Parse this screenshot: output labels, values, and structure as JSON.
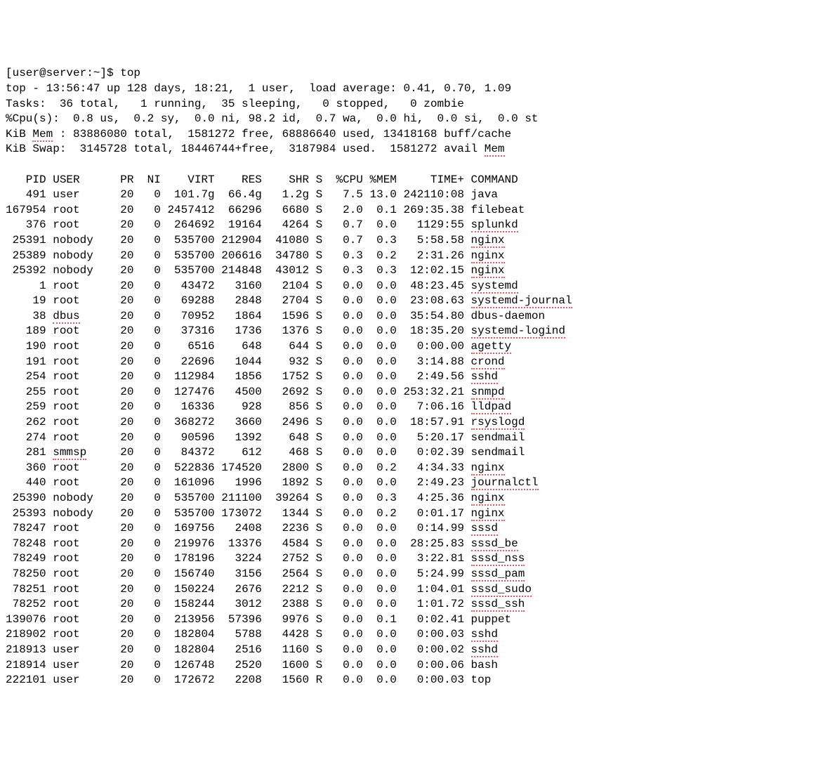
{
  "prompt": "[user@server:~]$ top",
  "summary": {
    "line1": "top - 13:56:47 up 128 days, 18:21,  1 user,  load average: 0.41, 0.70, 1.09",
    "line2": "Tasks:  36 total,   1 running,  35 sleeping,   0 stopped,   0 zombie",
    "line3": "%Cpu(s):  0.8 us,  0.2 sy,  0.0 ni, 98.2 id,  0.7 wa,  0.0 hi,  0.0 si,  0.0 st",
    "mem_prefix": "KiB ",
    "mem_word": "Mem",
    "mem_rest": " : 83886080 total,  1581272 free, 68886640 used, 13418168 buff/cache",
    "swap_prefix": "KiB Swap:  3145728 total, 18446744+free,  3187984 used.  1581272 avail ",
    "swap_word": "Mem"
  },
  "columns": {
    "pid": "PID",
    "user": "USER",
    "pr": "PR",
    "ni": "NI",
    "virt": "VIRT",
    "res": "RES",
    "shr": "SHR",
    "s": "S",
    "cpu": "%CPU",
    "mem": "%MEM",
    "time": "TIME+",
    "command": "COMMAND"
  },
  "processes": [
    {
      "pid": "491",
      "user": "user",
      "pr": "20",
      "ni": "0",
      "virt": "101.7g",
      "res": "66.4g",
      "shr": "1.2g",
      "s": "S",
      "cpu": "7.5",
      "mem": "13.0",
      "time": "242110:08",
      "command": "java",
      "underline": false
    },
    {
      "pid": "167954",
      "user": "root",
      "pr": "20",
      "ni": "0",
      "virt": "2457412",
      "res": "66296",
      "shr": "6680",
      "s": "S",
      "cpu": "2.0",
      "mem": "0.1",
      "time": "269:35.38",
      "command": "filebeat",
      "underline": false
    },
    {
      "pid": "376",
      "user": "root",
      "pr": "20",
      "ni": "0",
      "virt": "264692",
      "res": "19164",
      "shr": "4264",
      "s": "S",
      "cpu": "0.7",
      "mem": "0.0",
      "time": "1129:55",
      "command": "splunkd",
      "underline": true
    },
    {
      "pid": "25391",
      "user": "nobody",
      "pr": "20",
      "ni": "0",
      "virt": "535700",
      "res": "212904",
      "shr": "41080",
      "s": "S",
      "cpu": "0.7",
      "mem": "0.3",
      "time": "5:58.58",
      "command": "nginx",
      "underline": true
    },
    {
      "pid": "25389",
      "user": "nobody",
      "pr": "20",
      "ni": "0",
      "virt": "535700",
      "res": "206616",
      "shr": "34780",
      "s": "S",
      "cpu": "0.3",
      "mem": "0.2",
      "time": "2:31.26",
      "command": "nginx",
      "underline": true
    },
    {
      "pid": "25392",
      "user": "nobody",
      "pr": "20",
      "ni": "0",
      "virt": "535700",
      "res": "214848",
      "shr": "43012",
      "s": "S",
      "cpu": "0.3",
      "mem": "0.3",
      "time": "12:02.15",
      "command": "nginx",
      "underline": true
    },
    {
      "pid": "1",
      "user": "root",
      "pr": "20",
      "ni": "0",
      "virt": "43472",
      "res": "3160",
      "shr": "2104",
      "s": "S",
      "cpu": "0.0",
      "mem": "0.0",
      "time": "48:23.45",
      "command": "systemd",
      "underline": true
    },
    {
      "pid": "19",
      "user": "root",
      "pr": "20",
      "ni": "0",
      "virt": "69288",
      "res": "2848",
      "shr": "2704",
      "s": "S",
      "cpu": "0.0",
      "mem": "0.0",
      "time": "23:08.63",
      "command": "systemd-journal",
      "underline": true
    },
    {
      "pid": "38",
      "user": "dbus",
      "pr": "20",
      "ni": "0",
      "virt": "70952",
      "res": "1864",
      "shr": "1596",
      "s": "S",
      "cpu": "0.0",
      "mem": "0.0",
      "time": "35:54.80",
      "command": "dbus-daemon",
      "underline": false,
      "user_underline": true
    },
    {
      "pid": "189",
      "user": "root",
      "pr": "20",
      "ni": "0",
      "virt": "37316",
      "res": "1736",
      "shr": "1376",
      "s": "S",
      "cpu": "0.0",
      "mem": "0.0",
      "time": "18:35.20",
      "command": "systemd-logind",
      "underline": true
    },
    {
      "pid": "190",
      "user": "root",
      "pr": "20",
      "ni": "0",
      "virt": "6516",
      "res": "648",
      "shr": "644",
      "s": "S",
      "cpu": "0.0",
      "mem": "0.0",
      "time": "0:00.00",
      "command": "agetty",
      "underline": true
    },
    {
      "pid": "191",
      "user": "root",
      "pr": "20",
      "ni": "0",
      "virt": "22696",
      "res": "1044",
      "shr": "932",
      "s": "S",
      "cpu": "0.0",
      "mem": "0.0",
      "time": "3:14.88",
      "command": "crond",
      "underline": true
    },
    {
      "pid": "254",
      "user": "root",
      "pr": "20",
      "ni": "0",
      "virt": "112984",
      "res": "1856",
      "shr": "1752",
      "s": "S",
      "cpu": "0.0",
      "mem": "0.0",
      "time": "2:49.56",
      "command": "sshd",
      "underline": true
    },
    {
      "pid": "255",
      "user": "root",
      "pr": "20",
      "ni": "0",
      "virt": "127476",
      "res": "4500",
      "shr": "2692",
      "s": "S",
      "cpu": "0.0",
      "mem": "0.0",
      "time": "253:32.21",
      "command": "snmpd",
      "underline": true
    },
    {
      "pid": "259",
      "user": "root",
      "pr": "20",
      "ni": "0",
      "virt": "16336",
      "res": "928",
      "shr": "856",
      "s": "S",
      "cpu": "0.0",
      "mem": "0.0",
      "time": "7:06.16",
      "command": "lldpad",
      "underline": true
    },
    {
      "pid": "262",
      "user": "root",
      "pr": "20",
      "ni": "0",
      "virt": "368272",
      "res": "3660",
      "shr": "2496",
      "s": "S",
      "cpu": "0.0",
      "mem": "0.0",
      "time": "18:57.91",
      "command": "rsyslogd",
      "underline": true
    },
    {
      "pid": "274",
      "user": "root",
      "pr": "20",
      "ni": "0",
      "virt": "90596",
      "res": "1392",
      "shr": "648",
      "s": "S",
      "cpu": "0.0",
      "mem": "0.0",
      "time": "5:20.17",
      "command": "sendmail",
      "underline": false
    },
    {
      "pid": "281",
      "user": "smmsp",
      "pr": "20",
      "ni": "0",
      "virt": "84372",
      "res": "612",
      "shr": "468",
      "s": "S",
      "cpu": "0.0",
      "mem": "0.0",
      "time": "0:02.39",
      "command": "sendmail",
      "underline": false,
      "user_underline": true
    },
    {
      "pid": "360",
      "user": "root",
      "pr": "20",
      "ni": "0",
      "virt": "522836",
      "res": "174520",
      "shr": "2800",
      "s": "S",
      "cpu": "0.0",
      "mem": "0.2",
      "time": "4:34.33",
      "command": "nginx",
      "underline": true
    },
    {
      "pid": "440",
      "user": "root",
      "pr": "20",
      "ni": "0",
      "virt": "161096",
      "res": "1996",
      "shr": "1892",
      "s": "S",
      "cpu": "0.0",
      "mem": "0.0",
      "time": "2:49.23",
      "command": "journalctl",
      "underline": true
    },
    {
      "pid": "25390",
      "user": "nobody",
      "pr": "20",
      "ni": "0",
      "virt": "535700",
      "res": "211100",
      "shr": "39264",
      "s": "S",
      "cpu": "0.0",
      "mem": "0.3",
      "time": "4:25.36",
      "command": "nginx",
      "underline": true
    },
    {
      "pid": "25393",
      "user": "nobody",
      "pr": "20",
      "ni": "0",
      "virt": "535700",
      "res": "173072",
      "shr": "1344",
      "s": "S",
      "cpu": "0.0",
      "mem": "0.2",
      "time": "0:01.17",
      "command": "nginx",
      "underline": true
    },
    {
      "pid": "78247",
      "user": "root",
      "pr": "20",
      "ni": "0",
      "virt": "169756",
      "res": "2408",
      "shr": "2236",
      "s": "S",
      "cpu": "0.0",
      "mem": "0.0",
      "time": "0:14.99",
      "command": "sssd",
      "underline": true
    },
    {
      "pid": "78248",
      "user": "root",
      "pr": "20",
      "ni": "0",
      "virt": "219976",
      "res": "13376",
      "shr": "4584",
      "s": "S",
      "cpu": "0.0",
      "mem": "0.0",
      "time": "28:25.83",
      "command": "sssd_be",
      "underline": true
    },
    {
      "pid": "78249",
      "user": "root",
      "pr": "20",
      "ni": "0",
      "virt": "178196",
      "res": "3224",
      "shr": "2752",
      "s": "S",
      "cpu": "0.0",
      "mem": "0.0",
      "time": "3:22.81",
      "command": "sssd_nss",
      "underline": true
    },
    {
      "pid": "78250",
      "user": "root",
      "pr": "20",
      "ni": "0",
      "virt": "156740",
      "res": "3156",
      "shr": "2564",
      "s": "S",
      "cpu": "0.0",
      "mem": "0.0",
      "time": "5:24.99",
      "command": "sssd_pam",
      "underline": true
    },
    {
      "pid": "78251",
      "user": "root",
      "pr": "20",
      "ni": "0",
      "virt": "150224",
      "res": "2676",
      "shr": "2212",
      "s": "S",
      "cpu": "0.0",
      "mem": "0.0",
      "time": "1:04.01",
      "command": "sssd_sudo",
      "underline": true
    },
    {
      "pid": "78252",
      "user": "root",
      "pr": "20",
      "ni": "0",
      "virt": "158244",
      "res": "3012",
      "shr": "2388",
      "s": "S",
      "cpu": "0.0",
      "mem": "0.0",
      "time": "1:01.72",
      "command": "sssd_ssh",
      "underline": true
    },
    {
      "pid": "139076",
      "user": "root",
      "pr": "20",
      "ni": "0",
      "virt": "213956",
      "res": "57396",
      "shr": "9976",
      "s": "S",
      "cpu": "0.0",
      "mem": "0.1",
      "time": "0:02.41",
      "command": "puppet",
      "underline": false
    },
    {
      "pid": "218902",
      "user": "root",
      "pr": "20",
      "ni": "0",
      "virt": "182804",
      "res": "5788",
      "shr": "4428",
      "s": "S",
      "cpu": "0.0",
      "mem": "0.0",
      "time": "0:00.03",
      "command": "sshd",
      "underline": true
    },
    {
      "pid": "218913",
      "user": "user",
      "pr": "20",
      "ni": "0",
      "virt": "182804",
      "res": "2516",
      "shr": "1160",
      "s": "S",
      "cpu": "0.0",
      "mem": "0.0",
      "time": "0:00.02",
      "command": "sshd",
      "underline": true
    },
    {
      "pid": "218914",
      "user": "user",
      "pr": "20",
      "ni": "0",
      "virt": "126748",
      "res": "2520",
      "shr": "1600",
      "s": "S",
      "cpu": "0.0",
      "mem": "0.0",
      "time": "0:00.06",
      "command": "bash",
      "underline": false
    },
    {
      "pid": "222101",
      "user": "user",
      "pr": "20",
      "ni": "0",
      "virt": "172672",
      "res": "2208",
      "shr": "1560",
      "s": "R",
      "cpu": "0.0",
      "mem": "0.0",
      "time": "0:00.03",
      "command": "top",
      "underline": false
    }
  ]
}
